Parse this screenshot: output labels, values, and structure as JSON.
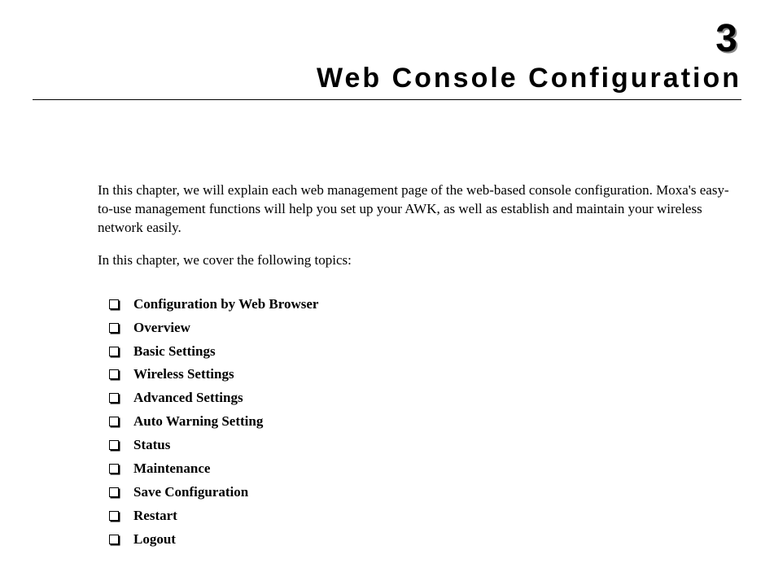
{
  "chapter": {
    "number": "3",
    "title": "Web Console Configuration"
  },
  "intro": {
    "p1": "In this chapter, we will explain each web management page of the web-based console configuration. Moxa's easy-to-use management functions will help you set up your AWK, as well as establish and maintain your wireless network easily.",
    "p2": "In this chapter, we cover the following topics:"
  },
  "topics": [
    "Configuration by Web Browser",
    "Overview",
    "Basic Settings",
    "Wireless Settings",
    "Advanced Settings",
    "Auto Warning Setting",
    "Status",
    "Maintenance",
    "Save Configuration",
    "Restart",
    "Logout"
  ]
}
